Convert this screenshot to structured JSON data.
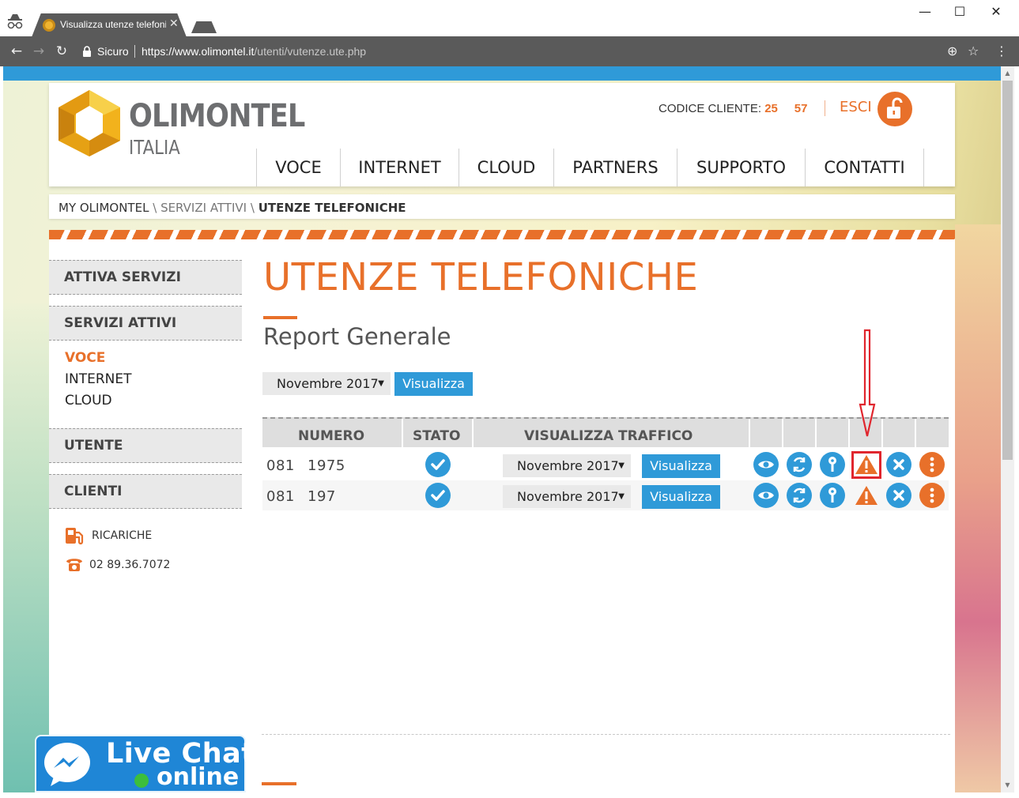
{
  "browser": {
    "tab_title": "Visualizza utenze telefoni",
    "secure_label": "Sicuro",
    "url_host": "https://www.olimontel.it",
    "url_path": "/utenti/vutenze.ute.php",
    "window_controls": {
      "minimize": "—",
      "maximize": "☐",
      "close": "✕"
    },
    "tab_close": "✕"
  },
  "header": {
    "logo_name": "OLIMONTEL",
    "logo_sub": "ITALIA",
    "codice_label": "CODICE CLIENTE:",
    "codice_part1": "25",
    "codice_part2": "57",
    "logout_label": "ESCI",
    "nav": [
      "VOCE",
      "INTERNET",
      "CLOUD",
      "PARTNERS",
      "SUPPORTO",
      "CONTATTI"
    ]
  },
  "breadcrumb": {
    "item1": "MY OLIMONTEL",
    "item2": "SERVIZI ATTIVI",
    "current": "UTENZE TELEFONICHE",
    "separator": "\\"
  },
  "sidebar": {
    "attiva_servizi": "ATTIVA SERVIZI",
    "servizi_attivi": "SERVIZI ATTIVI",
    "links": [
      "VOCE",
      "INTERNET",
      "CLOUD"
    ],
    "utente": "UTENTE",
    "clienti": "CLIENTI",
    "ricariche": "RICARICHE",
    "phone": "02 89.36.7072"
  },
  "main": {
    "title": "UTENZE TELEFONICHE",
    "subtitle": "Report Generale",
    "month_select": "Novembre 2017",
    "visualizza_button": "Visualizza"
  },
  "table": {
    "headers": [
      "NUMERO",
      "STATO",
      "VISUALIZZA TRAFFICO"
    ],
    "rows": [
      {
        "number_prefix": "081",
        "number_suffix": "1975",
        "month": "Novembre 2017",
        "button": "Visualizza"
      },
      {
        "number_prefix": "081",
        "number_suffix": "197",
        "month": "Novembre 2017",
        "button": "Visualizza"
      }
    ]
  },
  "live_chat": {
    "title": "Live Chat",
    "status": "online"
  },
  "colors": {
    "accent": "#e8702a",
    "blue": "#2f9ad8",
    "highlight": "#e0262e"
  }
}
